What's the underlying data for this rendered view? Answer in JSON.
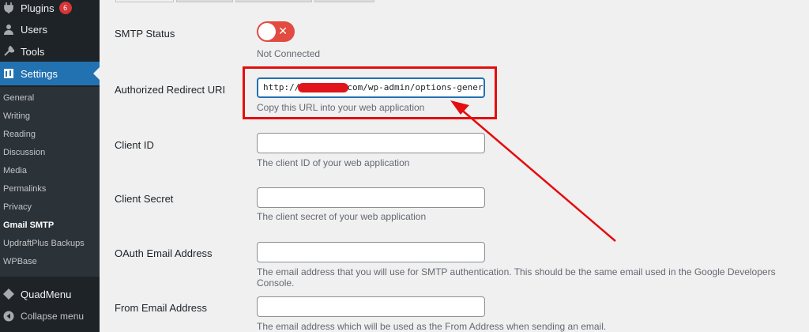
{
  "sidebar": {
    "top_items": [
      {
        "label": "Plugins",
        "badge": "6",
        "icon": "plugin-icon"
      },
      {
        "label": "Users",
        "icon": "users-icon"
      },
      {
        "label": "Tools",
        "icon": "wrench-icon"
      },
      {
        "label": "Settings",
        "icon": "settings-icon"
      }
    ],
    "submenu": [
      "General",
      "Writing",
      "Reading",
      "Discussion",
      "Media",
      "Permalinks",
      "Privacy",
      "Gmail SMTP",
      "UpdraftPlus Backups",
      "WPBase"
    ],
    "bottom_items": [
      {
        "label": "QuadMenu",
        "icon": "quadmenu-icon"
      },
      {
        "label": "Collapse menu",
        "icon": "collapse-icon"
      }
    ]
  },
  "form": {
    "smtp_status": {
      "label": "SMTP Status",
      "status": "Not Connected",
      "toggle_symbol": "✕"
    },
    "redirect_uri": {
      "label": "Authorized Redirect URI",
      "value_prefix": "http://",
      "value_suffix": "com/wp-admin/options-genera",
      "description": "Copy this URL into your web application"
    },
    "client_id": {
      "label": "Client ID",
      "description": "The client ID of your web application"
    },
    "client_secret": {
      "label": "Client Secret",
      "description": "The client secret of your web application"
    },
    "oauth_email": {
      "label": "OAuth Email Address",
      "description": "The email address that you will use for SMTP authentication. This should be the same email used in the Google Developers Console."
    },
    "from_email": {
      "label": "From Email Address",
      "description": "The email address which will be used as the From Address when sending an email."
    }
  },
  "colors": {
    "sidebar_bg": "#1d2327",
    "active_bg": "#2271b1",
    "annotation_red": "#e50d0d",
    "toggle_red": "#e24b40",
    "badge_red": "#d63638"
  }
}
